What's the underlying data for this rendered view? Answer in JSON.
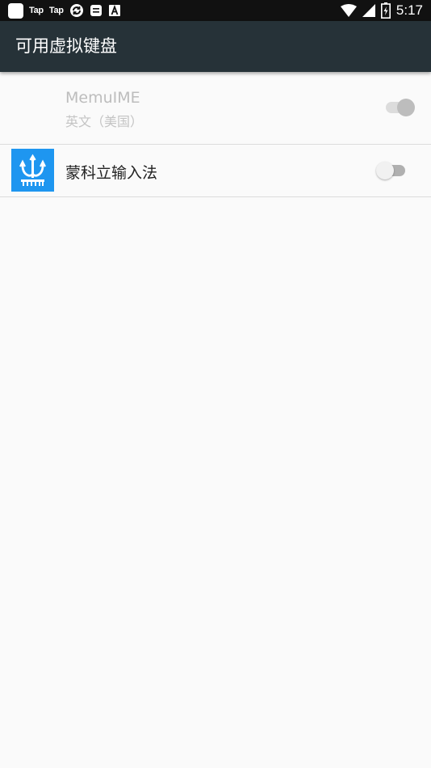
{
  "status_bar": {
    "left_icons": [
      "app-square-icon",
      "taptap-icon",
      "taptap-icon",
      "sync-icon",
      "message-icon",
      "font-icon"
    ],
    "tap_label_1": "Tap",
    "tap_label_2": "Tap",
    "right_icons": [
      "wifi-icon",
      "signal-icon",
      "battery-icon"
    ],
    "time": "5:17"
  },
  "toolbar": {
    "title": "可用虚拟键盘",
    "background": "#263238"
  },
  "keyboards": [
    {
      "name": "MemuIME",
      "subtitle": "英文（美国）",
      "enabled": true,
      "disabled_appearance": true,
      "icon": null
    },
    {
      "name": "蒙科立输入法",
      "enabled": false,
      "icon": "menksoft-trident-icon",
      "icon_color": "#1e96f0"
    }
  ]
}
